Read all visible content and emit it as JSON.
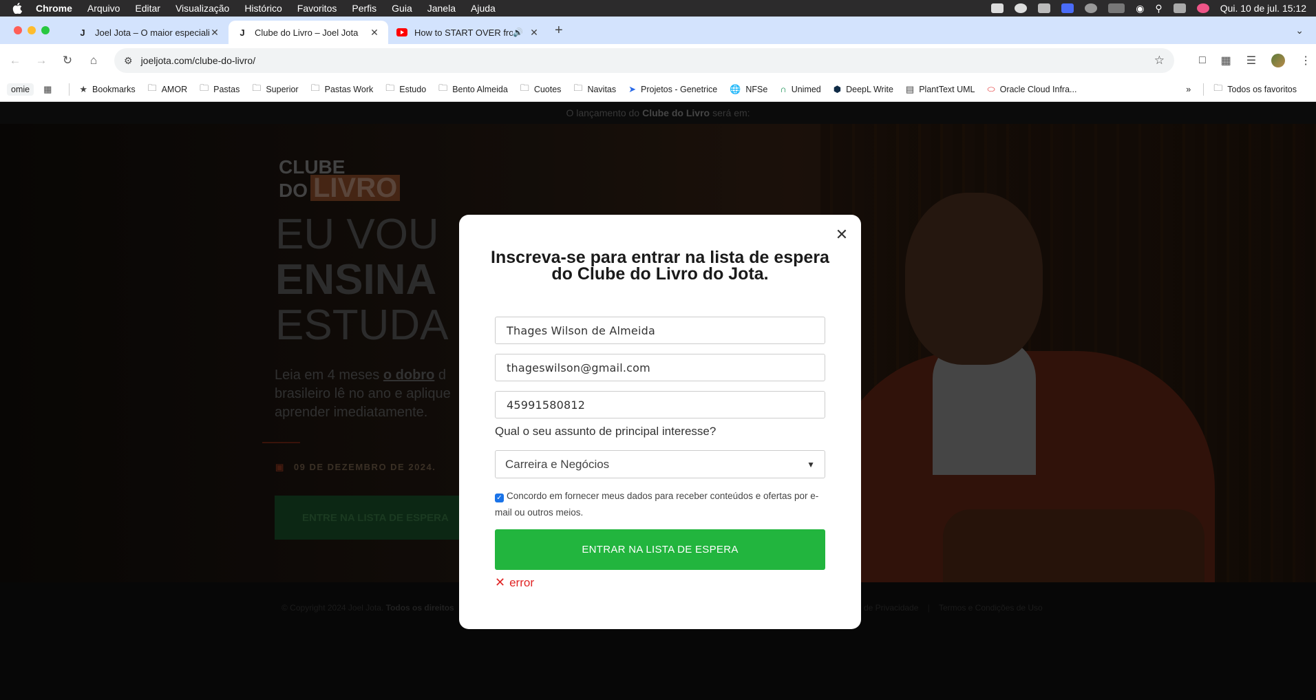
{
  "menubar": {
    "app": "Chrome",
    "items": [
      "Arquivo",
      "Editar",
      "Visualização",
      "Histórico",
      "Favoritos",
      "Perfis",
      "Guia",
      "Janela",
      "Ajuda"
    ],
    "clock": "Qui. 10 de jul.  15:12"
  },
  "tabs": [
    {
      "title": "Joel Jota – O maior especiali",
      "favicon": "J"
    },
    {
      "title": "Clube do Livro – Joel Jota",
      "favicon": "J"
    },
    {
      "title": "How to START OVER from",
      "favicon": "youtube-icon"
    }
  ],
  "toolbar": {
    "url": "joeljota.com/clube-do-livro/"
  },
  "bookmarks": {
    "items": [
      "omie",
      "Bookmarks",
      "AMOR",
      "Pastas",
      "Superior",
      "Pastas Work",
      "Estudo",
      "Bento Almeida",
      "Cuotes",
      "Navitas",
      "Projetos - Genetrice",
      "NFSe",
      "Unimed",
      "DeepL Write",
      "PlantText UML",
      "Oracle Cloud Infra..."
    ],
    "all_favorites": "Todos os favoritos"
  },
  "page": {
    "launch_prefix": "O lançamento do",
    "launch_bold": "Clube do Livro",
    "launch_suffix": "será em:",
    "logo_top": "CLUBE",
    "logo_do": "DO",
    "logo_livro": "LIVRO",
    "headline": [
      "EU VOU",
      "ENSINA",
      "ESTUDA"
    ],
    "sub_prefix": "Leia em 4 meses",
    "sub_bold": "o dobro",
    "sub_rest": "d brasileiro lê no ano e aplique aprender imediatamente.",
    "date": "09 DE DEZEMBRO DE 2024.",
    "hero_button": "ENTRE NA LISTA DE ESPERA",
    "copyright": "© Copyright 2024 Joel Jota.",
    "rights": "Todos os direitos",
    "privacy": "de Privacidade",
    "terms": "Termos e Condições de Uso"
  },
  "modal": {
    "title": "Inscreva-se para entrar na lista de espera do Clube do Livro do Jota.",
    "name_value": "Thages Wilson de Almeida",
    "email_value": "thageswilson@gmail.com",
    "phone_value": "45991580812",
    "question": "Qual o seu assunto de principal interesse?",
    "interest_selected": "Carreira e Negócios",
    "consent": "Concordo em fornecer meus dados para receber conteúdos e ofertas por e-mail ou outros meios.",
    "consent_checked": true,
    "submit_label": "ENTRAR NA LISTA DE ESPERA",
    "error_text": "error",
    "accent_color": "#22b53e",
    "error_color": "#e02424"
  }
}
